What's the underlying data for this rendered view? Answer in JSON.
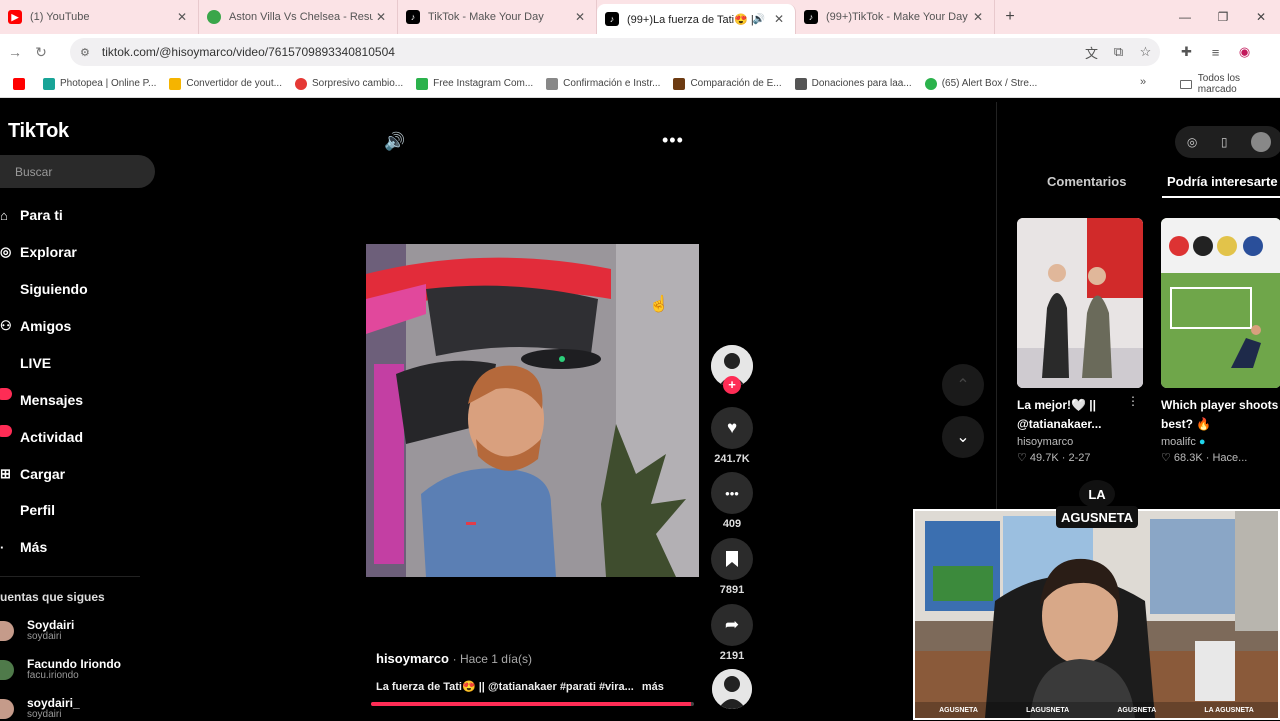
{
  "browser": {
    "tabs": [
      {
        "title": "(1) YouTube",
        "favicon": "youtube-icon",
        "active": false
      },
      {
        "title": "Aston Villa Vs Chelsea - Resulta",
        "favicon": "soccer-ball-icon",
        "active": false
      },
      {
        "title": "TikTok - Make Your Day",
        "favicon": "tiktok-icon",
        "active": false
      },
      {
        "title": "(99+)La fuerza de Tati😍 || @",
        "favicon": "tiktok-icon",
        "active": true
      },
      {
        "title": "(99+)TikTok - Make Your Day",
        "favicon": "tiktok-icon",
        "active": false
      }
    ],
    "new_tab": "+",
    "window_controls": {
      "minimize": "—",
      "restore": "❐",
      "close": "✕"
    },
    "url": "tiktok.com/@hisoymarco/video/7615709893340810504",
    "bookmarks": [
      {
        "label": "",
        "color": "#ff0000"
      },
      {
        "label": "Photopea | Online P...",
        "color": "#18a497"
      },
      {
        "label": "Convertidor de yout...",
        "color": "#f5b400"
      },
      {
        "label": "Sorpresivo cambio...",
        "color": "#e53935"
      },
      {
        "label": "Free Instagram Com...",
        "color": "#2bb24c"
      },
      {
        "label": "Confirmación e Instr...",
        "color": "#888888"
      },
      {
        "label": "Comparación de E...",
        "color": "#6d3b12"
      },
      {
        "label": "Donaciones para laa...",
        "color": "#555555"
      },
      {
        "label": "(65) Alert Box / Stre...",
        "color": "#2bb24c"
      }
    ],
    "bookmarks_more": "»",
    "all_bookmarks": "Todos los marcado"
  },
  "tiktok": {
    "logo": "TikTok",
    "search_placeholder": "Buscar",
    "nav": [
      {
        "label": "Para ti",
        "icon": "home-icon",
        "badge": false
      },
      {
        "label": "Explorar",
        "icon": "compass-icon",
        "badge": false
      },
      {
        "label": "Siguiendo",
        "icon": "following-icon",
        "badge": false
      },
      {
        "label": "Amigos",
        "icon": "friends-icon",
        "badge": false
      },
      {
        "label": "LIVE",
        "icon": "live-icon",
        "badge": false
      },
      {
        "label": "Mensajes",
        "icon": "messages-icon",
        "badge": true
      },
      {
        "label": "Actividad",
        "icon": "activity-icon",
        "badge": true
      },
      {
        "label": "Cargar",
        "icon": "upload-icon",
        "badge": false
      },
      {
        "label": "Perfil",
        "icon": "profile-icon",
        "badge": false
      },
      {
        "label": "Más",
        "icon": "more-icon",
        "badge": false
      }
    ],
    "following_heading": "uentas que sigues",
    "following": [
      {
        "name": "Soydairi",
        "handle": "soydairi"
      },
      {
        "name": "Facundo Iriondo",
        "handle": "facu.iriondo"
      },
      {
        "name": "soydairi_",
        "handle": "soydairi"
      }
    ],
    "video": {
      "author": "hisoymarco",
      "time": "· Hace 1 día(s)",
      "caption": "La fuerza de Tati😍 || @tatianakaer #parati #vira...",
      "more": "más",
      "progress": 0.99,
      "likes": "241.7K",
      "comments": "409",
      "saves": "7891",
      "shares": "2191"
    },
    "right_panel": {
      "tabs": [
        "Comentarios",
        "Podría interesarte"
      ],
      "cards": [
        {
          "title": "La mejor!🤍 || @tatianakaer...",
          "author": "hisoymarco",
          "likes": "49.7K",
          "date": "2-27"
        },
        {
          "title": "Which player shoots best? 🔥",
          "author": "moalifc",
          "likes": "68.3K",
          "date": "Hace..."
        }
      ]
    }
  },
  "webcam": {
    "logo_text": "LA AGUSNETA",
    "socials": [
      "AGUSNETA",
      "LAGUSNETA",
      "AGUSNETA",
      "LA AGUSNETA"
    ]
  },
  "colors": {
    "accent": "#fe2c55",
    "tabbar": "#fbe3e6"
  }
}
